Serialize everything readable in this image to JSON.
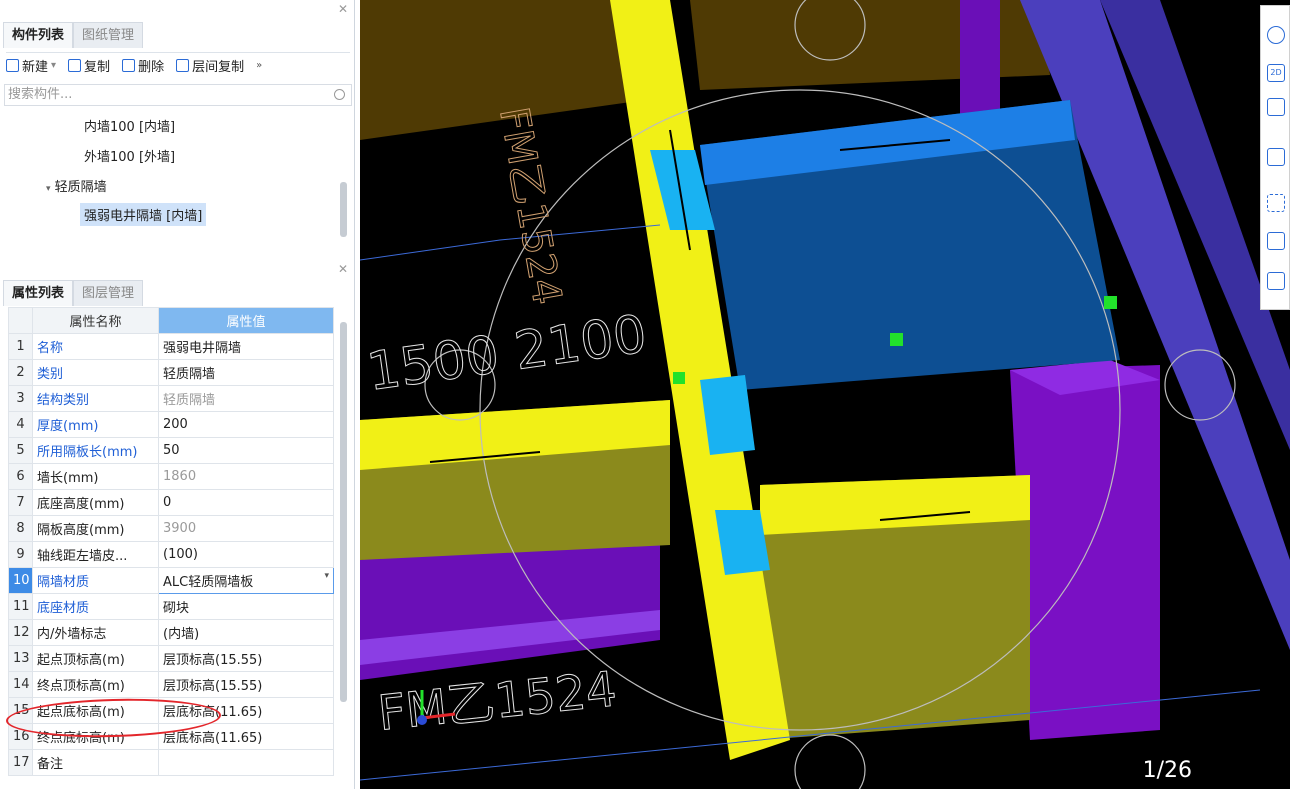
{
  "component_panel": {
    "tabs": [
      "构件列表",
      "图纸管理"
    ],
    "toolbar": [
      "新建",
      "复制",
      "删除",
      "层间复制"
    ],
    "search_placeholder": "搜索构件...",
    "tree": [
      {
        "label": "内墙100 [内墙]"
      },
      {
        "label": "外墙100 [外墙]"
      },
      {
        "label": "轻质隔墙"
      },
      {
        "label": "强弱电井隔墙 [内墙]"
      }
    ]
  },
  "property_panel": {
    "tabs": [
      "属性列表",
      "图层管理"
    ],
    "headers": {
      "name": "属性名称",
      "value": "属性值"
    },
    "rows": [
      {
        "idx": "1",
        "name": "名称",
        "value": "强弱电井隔墙"
      },
      {
        "idx": "2",
        "name": "类别",
        "value": "轻质隔墙"
      },
      {
        "idx": "3",
        "name": "结构类别",
        "value": "轻质隔墙"
      },
      {
        "idx": "4",
        "name": "厚度(mm)",
        "value": "200"
      },
      {
        "idx": "5",
        "name": "所用隔板长(mm)",
        "value": "50"
      },
      {
        "idx": "6",
        "name": "墙长(mm)",
        "value": "1860"
      },
      {
        "idx": "7",
        "name": "底座高度(mm)",
        "value": "0"
      },
      {
        "idx": "8",
        "name": "隔板高度(mm)",
        "value": "3900"
      },
      {
        "idx": "9",
        "name": "轴线距左墙皮...",
        "value": "(100)"
      },
      {
        "idx": "10",
        "name": "隔墙材质",
        "value": "ALC轻质隔墙板"
      },
      {
        "idx": "11",
        "name": "底座材质",
        "value": "砌块"
      },
      {
        "idx": "12",
        "name": "内/外墙标志",
        "value": "(内墙)"
      },
      {
        "idx": "13",
        "name": "起点顶标高(m)",
        "value": "层顶标高(15.55)"
      },
      {
        "idx": "14",
        "name": "终点顶标高(m)",
        "value": "层顶标高(15.55)"
      },
      {
        "idx": "15",
        "name": "起点底标高(m)",
        "value": "层底标高(11.65)"
      },
      {
        "idx": "16",
        "name": "终点底标高(m)",
        "value": "层底标高(11.65)"
      },
      {
        "idx": "17",
        "name": "备注",
        "value": ""
      }
    ]
  },
  "viewport": {
    "page_counter": "1/26",
    "right_toolbar_label": "2D",
    "cad_labels": [
      "FM乙1524",
      "1500 2100",
      "FM乙1524"
    ]
  }
}
